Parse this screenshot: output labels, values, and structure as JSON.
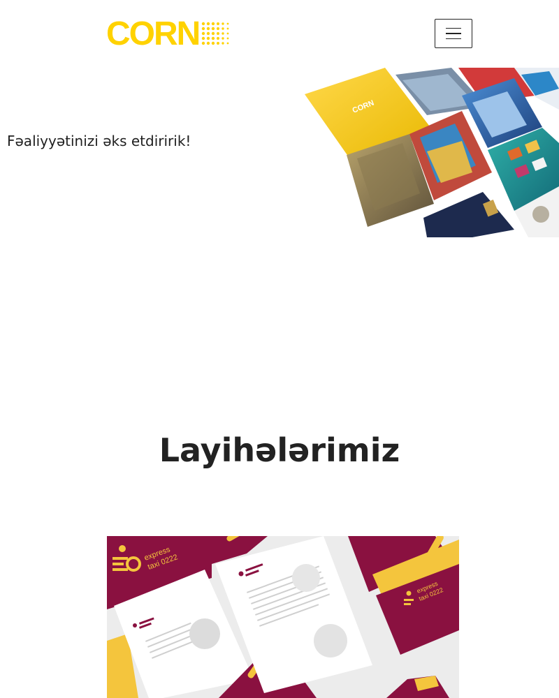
{
  "header": {
    "logo_text": "CORN",
    "menu_icon": "hamburger-icon"
  },
  "hero": {
    "tagline": "Fəaliyyətinizi əks etdiririk!",
    "cover_text": "CORN"
  },
  "projects": {
    "title": "Layihələrimiz",
    "card": {
      "brand_line1": "express",
      "brand_line2": "taxi 0222"
    }
  },
  "colors": {
    "brand_yellow": "#ffd200",
    "maroon": "#8a1140",
    "text": "#222222"
  }
}
